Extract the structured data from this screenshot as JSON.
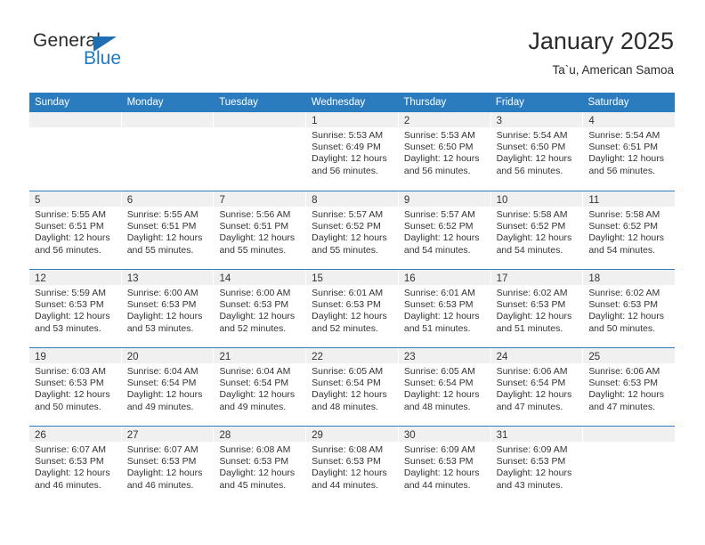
{
  "brand": {
    "name_part1": "General",
    "name_part2": "Blue",
    "triangle_color": "#1f6fb5",
    "blue_color": "#1f7ac4"
  },
  "header": {
    "title": "January 2025",
    "subtitle": "Ta`u, American Samoa"
  },
  "theme": {
    "header_blue": "#2b7cbf",
    "daynum_band": "#f0f0f0",
    "text": "#333333"
  },
  "weekdays": [
    "Sunday",
    "Monday",
    "Tuesday",
    "Wednesday",
    "Thursday",
    "Friday",
    "Saturday"
  ],
  "weeks": [
    [
      {
        "day": "",
        "sunrise": "",
        "sunset": "",
        "daylight_line1": "",
        "daylight_line2": ""
      },
      {
        "day": "",
        "sunrise": "",
        "sunset": "",
        "daylight_line1": "",
        "daylight_line2": ""
      },
      {
        "day": "",
        "sunrise": "",
        "sunset": "",
        "daylight_line1": "",
        "daylight_line2": ""
      },
      {
        "day": "1",
        "sunrise": "Sunrise: 5:53 AM",
        "sunset": "Sunset: 6:49 PM",
        "daylight_line1": "Daylight: 12 hours",
        "daylight_line2": "and 56 minutes."
      },
      {
        "day": "2",
        "sunrise": "Sunrise: 5:53 AM",
        "sunset": "Sunset: 6:50 PM",
        "daylight_line1": "Daylight: 12 hours",
        "daylight_line2": "and 56 minutes."
      },
      {
        "day": "3",
        "sunrise": "Sunrise: 5:54 AM",
        "sunset": "Sunset: 6:50 PM",
        "daylight_line1": "Daylight: 12 hours",
        "daylight_line2": "and 56 minutes."
      },
      {
        "day": "4",
        "sunrise": "Sunrise: 5:54 AM",
        "sunset": "Sunset: 6:51 PM",
        "daylight_line1": "Daylight: 12 hours",
        "daylight_line2": "and 56 minutes."
      }
    ],
    [
      {
        "day": "5",
        "sunrise": "Sunrise: 5:55 AM",
        "sunset": "Sunset: 6:51 PM",
        "daylight_line1": "Daylight: 12 hours",
        "daylight_line2": "and 56 minutes."
      },
      {
        "day": "6",
        "sunrise": "Sunrise: 5:55 AM",
        "sunset": "Sunset: 6:51 PM",
        "daylight_line1": "Daylight: 12 hours",
        "daylight_line2": "and 55 minutes."
      },
      {
        "day": "7",
        "sunrise": "Sunrise: 5:56 AM",
        "sunset": "Sunset: 6:51 PM",
        "daylight_line1": "Daylight: 12 hours",
        "daylight_line2": "and 55 minutes."
      },
      {
        "day": "8",
        "sunrise": "Sunrise: 5:57 AM",
        "sunset": "Sunset: 6:52 PM",
        "daylight_line1": "Daylight: 12 hours",
        "daylight_line2": "and 55 minutes."
      },
      {
        "day": "9",
        "sunrise": "Sunrise: 5:57 AM",
        "sunset": "Sunset: 6:52 PM",
        "daylight_line1": "Daylight: 12 hours",
        "daylight_line2": "and 54 minutes."
      },
      {
        "day": "10",
        "sunrise": "Sunrise: 5:58 AM",
        "sunset": "Sunset: 6:52 PM",
        "daylight_line1": "Daylight: 12 hours",
        "daylight_line2": "and 54 minutes."
      },
      {
        "day": "11",
        "sunrise": "Sunrise: 5:58 AM",
        "sunset": "Sunset: 6:52 PM",
        "daylight_line1": "Daylight: 12 hours",
        "daylight_line2": "and 54 minutes."
      }
    ],
    [
      {
        "day": "12",
        "sunrise": "Sunrise: 5:59 AM",
        "sunset": "Sunset: 6:53 PM",
        "daylight_line1": "Daylight: 12 hours",
        "daylight_line2": "and 53 minutes."
      },
      {
        "day": "13",
        "sunrise": "Sunrise: 6:00 AM",
        "sunset": "Sunset: 6:53 PM",
        "daylight_line1": "Daylight: 12 hours",
        "daylight_line2": "and 53 minutes."
      },
      {
        "day": "14",
        "sunrise": "Sunrise: 6:00 AM",
        "sunset": "Sunset: 6:53 PM",
        "daylight_line1": "Daylight: 12 hours",
        "daylight_line2": "and 52 minutes."
      },
      {
        "day": "15",
        "sunrise": "Sunrise: 6:01 AM",
        "sunset": "Sunset: 6:53 PM",
        "daylight_line1": "Daylight: 12 hours",
        "daylight_line2": "and 52 minutes."
      },
      {
        "day": "16",
        "sunrise": "Sunrise: 6:01 AM",
        "sunset": "Sunset: 6:53 PM",
        "daylight_line1": "Daylight: 12 hours",
        "daylight_line2": "and 51 minutes."
      },
      {
        "day": "17",
        "sunrise": "Sunrise: 6:02 AM",
        "sunset": "Sunset: 6:53 PM",
        "daylight_line1": "Daylight: 12 hours",
        "daylight_line2": "and 51 minutes."
      },
      {
        "day": "18",
        "sunrise": "Sunrise: 6:02 AM",
        "sunset": "Sunset: 6:53 PM",
        "daylight_line1": "Daylight: 12 hours",
        "daylight_line2": "and 50 minutes."
      }
    ],
    [
      {
        "day": "19",
        "sunrise": "Sunrise: 6:03 AM",
        "sunset": "Sunset: 6:53 PM",
        "daylight_line1": "Daylight: 12 hours",
        "daylight_line2": "and 50 minutes."
      },
      {
        "day": "20",
        "sunrise": "Sunrise: 6:04 AM",
        "sunset": "Sunset: 6:54 PM",
        "daylight_line1": "Daylight: 12 hours",
        "daylight_line2": "and 49 minutes."
      },
      {
        "day": "21",
        "sunrise": "Sunrise: 6:04 AM",
        "sunset": "Sunset: 6:54 PM",
        "daylight_line1": "Daylight: 12 hours",
        "daylight_line2": "and 49 minutes."
      },
      {
        "day": "22",
        "sunrise": "Sunrise: 6:05 AM",
        "sunset": "Sunset: 6:54 PM",
        "daylight_line1": "Daylight: 12 hours",
        "daylight_line2": "and 48 minutes."
      },
      {
        "day": "23",
        "sunrise": "Sunrise: 6:05 AM",
        "sunset": "Sunset: 6:54 PM",
        "daylight_line1": "Daylight: 12 hours",
        "daylight_line2": "and 48 minutes."
      },
      {
        "day": "24",
        "sunrise": "Sunrise: 6:06 AM",
        "sunset": "Sunset: 6:54 PM",
        "daylight_line1": "Daylight: 12 hours",
        "daylight_line2": "and 47 minutes."
      },
      {
        "day": "25",
        "sunrise": "Sunrise: 6:06 AM",
        "sunset": "Sunset: 6:53 PM",
        "daylight_line1": "Daylight: 12 hours",
        "daylight_line2": "and 47 minutes."
      }
    ],
    [
      {
        "day": "26",
        "sunrise": "Sunrise: 6:07 AM",
        "sunset": "Sunset: 6:53 PM",
        "daylight_line1": "Daylight: 12 hours",
        "daylight_line2": "and 46 minutes."
      },
      {
        "day": "27",
        "sunrise": "Sunrise: 6:07 AM",
        "sunset": "Sunset: 6:53 PM",
        "daylight_line1": "Daylight: 12 hours",
        "daylight_line2": "and 46 minutes."
      },
      {
        "day": "28",
        "sunrise": "Sunrise: 6:08 AM",
        "sunset": "Sunset: 6:53 PM",
        "daylight_line1": "Daylight: 12 hours",
        "daylight_line2": "and 45 minutes."
      },
      {
        "day": "29",
        "sunrise": "Sunrise: 6:08 AM",
        "sunset": "Sunset: 6:53 PM",
        "daylight_line1": "Daylight: 12 hours",
        "daylight_line2": "and 44 minutes."
      },
      {
        "day": "30",
        "sunrise": "Sunrise: 6:09 AM",
        "sunset": "Sunset: 6:53 PM",
        "daylight_line1": "Daylight: 12 hours",
        "daylight_line2": "and 44 minutes."
      },
      {
        "day": "31",
        "sunrise": "Sunrise: 6:09 AM",
        "sunset": "Sunset: 6:53 PM",
        "daylight_line1": "Daylight: 12 hours",
        "daylight_line2": "and 43 minutes."
      },
      {
        "day": "",
        "sunrise": "",
        "sunset": "",
        "daylight_line1": "",
        "daylight_line2": ""
      }
    ]
  ]
}
